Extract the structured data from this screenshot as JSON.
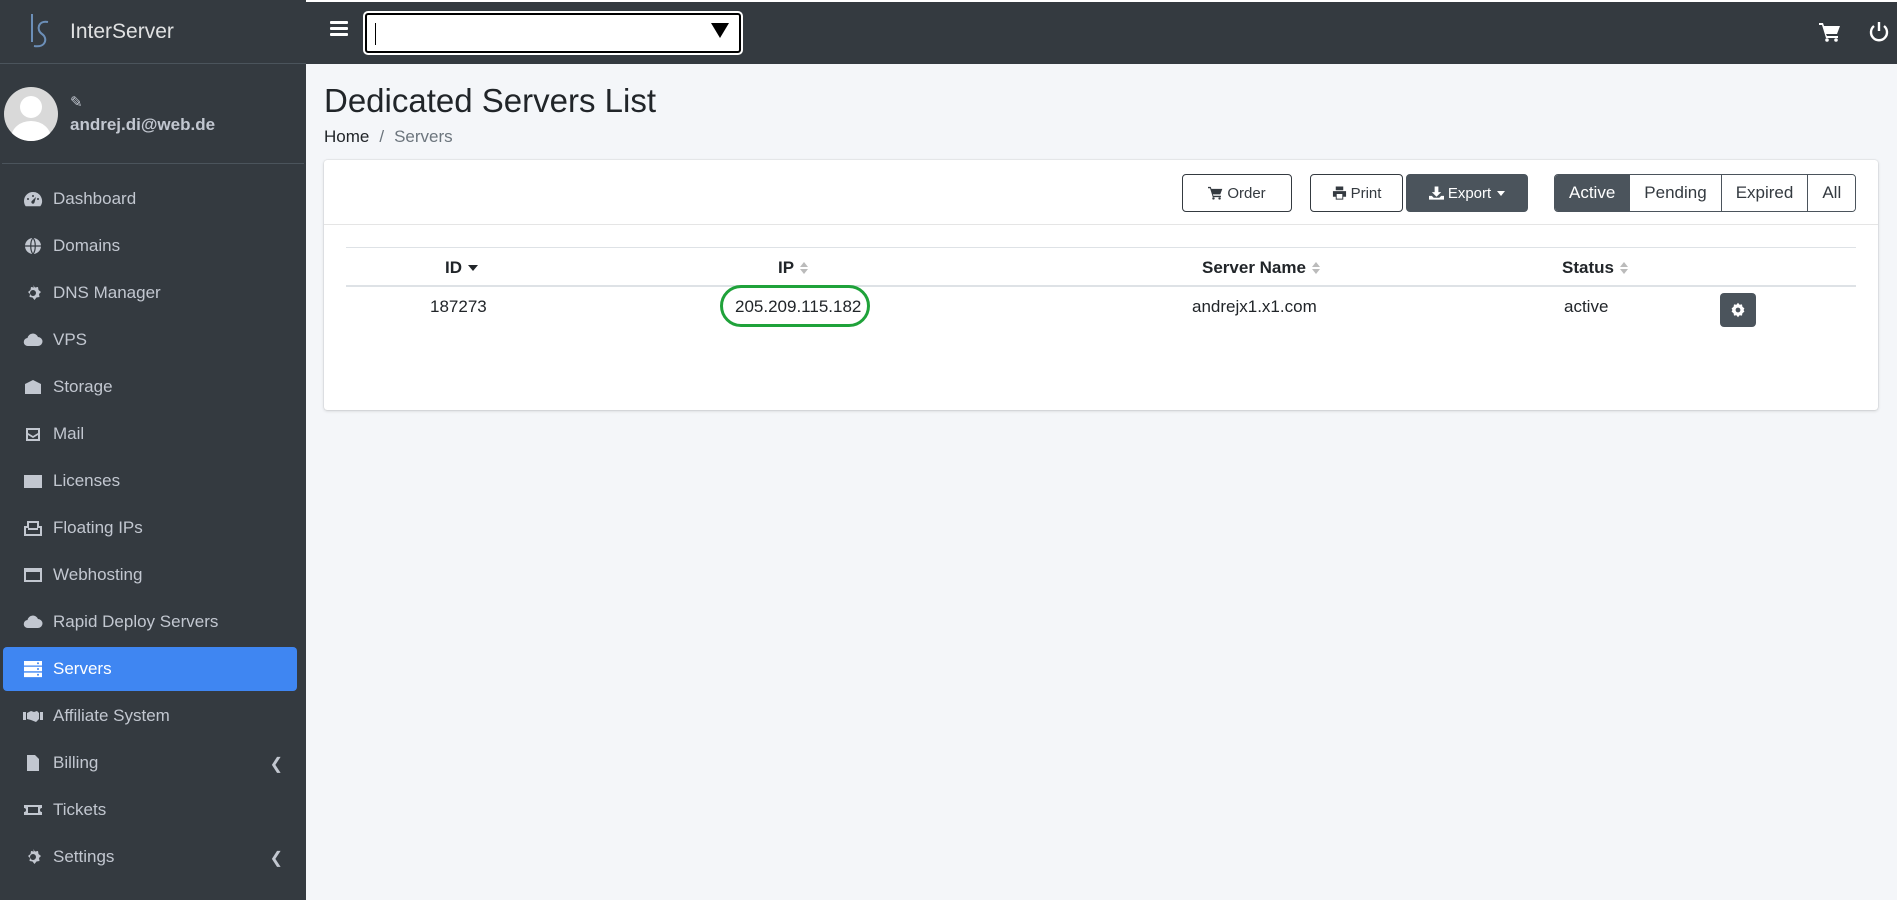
{
  "brand": {
    "name": "InterServer"
  },
  "user": {
    "email": "andrej.di@web.de"
  },
  "sidebar": {
    "items": [
      {
        "label": "Dashboard",
        "icon": "dashboard-icon"
      },
      {
        "label": "Domains",
        "icon": "globe-icon"
      },
      {
        "label": "DNS Manager",
        "icon": "cog-icon"
      },
      {
        "label": "VPS",
        "icon": "cloud-cog-icon"
      },
      {
        "label": "Storage",
        "icon": "storage-icon"
      },
      {
        "label": "Mail",
        "icon": "mail-icon"
      },
      {
        "label": "Licenses",
        "icon": "id-card-icon"
      },
      {
        "label": "Floating IPs",
        "icon": "inbox-icon"
      },
      {
        "label": "Webhosting",
        "icon": "window-icon"
      },
      {
        "label": "Rapid Deploy Servers",
        "icon": "cloud-icon"
      },
      {
        "label": "Servers",
        "icon": "server-icon",
        "active": true
      },
      {
        "label": "Affiliate System",
        "icon": "handshake-icon"
      },
      {
        "label": "Billing",
        "icon": "invoice-icon",
        "has_submenu": true
      },
      {
        "label": "Tickets",
        "icon": "ticket-icon"
      },
      {
        "label": "Settings",
        "icon": "gear-icon",
        "has_submenu": true
      }
    ]
  },
  "page": {
    "title": "Dedicated Servers List",
    "breadcrumb": {
      "home": "Home",
      "separator": "/",
      "current": "Servers"
    }
  },
  "toolbar": {
    "order_label": "Order",
    "print_label": "Print",
    "export_label": "Export",
    "filters": [
      {
        "label": "Active",
        "active": true
      },
      {
        "label": "Pending"
      },
      {
        "label": "Expired"
      },
      {
        "label": "All"
      }
    ]
  },
  "table": {
    "columns": [
      "ID",
      "IP",
      "Server Name",
      "Status"
    ],
    "rows": [
      {
        "id": "187273",
        "ip": "205.209.115.182",
        "server_name": "andrejx1.x1.com",
        "status": "active"
      }
    ]
  },
  "colors": {
    "sidebar_bg": "#343a40",
    "active_item": "#3f86f2",
    "highlight": "#1fa23a"
  }
}
